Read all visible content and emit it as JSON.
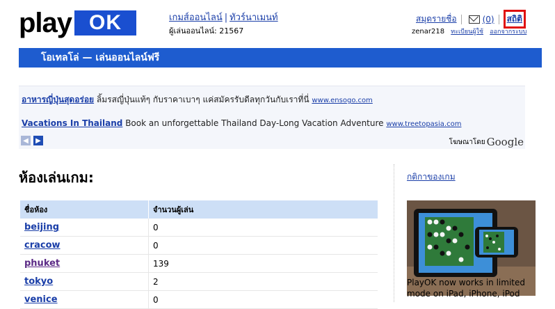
{
  "logo": {
    "play": "play",
    "ok": "OK"
  },
  "topnav": {
    "games_online": "เกมส์ออนไลน์",
    "separator": "|",
    "tournaments": "ทัวร์นาเมนท์",
    "players_online_label": "ผู้เล่นออนไลน์:",
    "players_online_count": "21567"
  },
  "rightnav": {
    "address_book": "สมุดรายชื่อ",
    "messages_count": "(0)",
    "stats": "สถิติ",
    "username": "zenar218",
    "register": "ทะเบียนผู้ใช้",
    "logout": "ออกจากระบบ"
  },
  "banner": {
    "title": "โอเทลโล่ — เล่นออนไลน์ฟรี"
  },
  "ads": {
    "items": [
      {
        "title": "อาหารญี่ปุ่นสุดอร่อย",
        "text": "ลิ้มรสญี่ปุ่นแท้ๆ กับราคาเบาๆ แค่สมัครรับดีลทุกวันกับเราที่นี่",
        "url": "www.ensogo.com"
      },
      {
        "title": "Vacations In Thailand",
        "text": "Book an unforgettable Thailand Day-Long Vacation Adventure",
        "url": "www.treetopasia.com"
      }
    ],
    "prev": "◀",
    "next": "▶",
    "ads_by": "โฆษณาโดย",
    "google": "Google"
  },
  "rooms": {
    "title": "ห้องเล่นเกม:",
    "headers": [
      "ชื่อห้อง",
      "จำนวนผู้เล่น"
    ],
    "rows": [
      {
        "name": "beijing",
        "players": "0"
      },
      {
        "name": "cracow",
        "players": "0"
      },
      {
        "name": "phuket",
        "players": "139"
      },
      {
        "name": "tokyo",
        "players": "2"
      },
      {
        "name": "venice",
        "players": "0"
      }
    ]
  },
  "sidebar": {
    "rules_link": "กติกาของเกม",
    "promo_text": "PlayOK now works in limited mode on iPad, iPhone, iPod"
  }
}
